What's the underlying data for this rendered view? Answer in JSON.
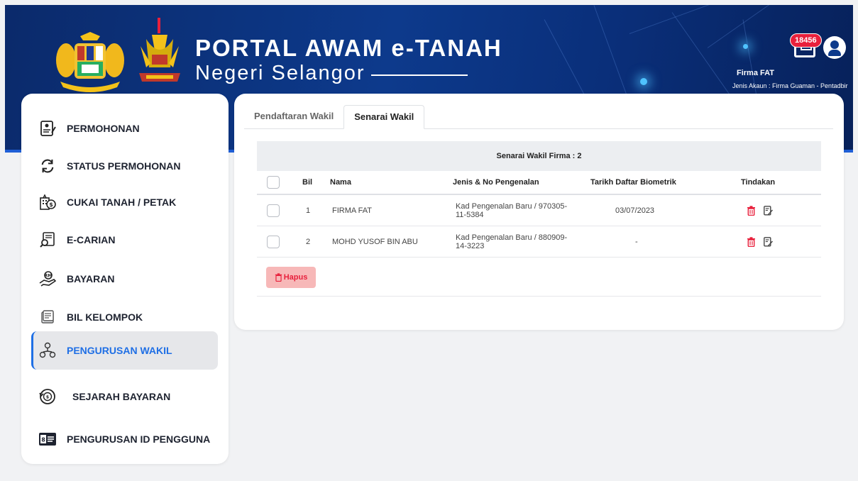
{
  "header": {
    "title": "PORTAL AWAM e-TANAH",
    "subtitle": "Negeri Selangor",
    "inbox_count": "18456",
    "user_name": "Firma FAT",
    "account_type": "Jenis Akaun : Firma Guaman - Pentadbir",
    "colors": {
      "header_bg": "#0d3a8c",
      "accent": "#1f6fe5",
      "badge": "#e8203c"
    }
  },
  "sidebar": {
    "items": [
      {
        "label": "PERMOHONAN",
        "icon": "form-document-icon"
      },
      {
        "label": "STATUS PERMOHONAN",
        "icon": "refresh-icon"
      },
      {
        "label": "CUKAI TANAH / PETAK",
        "icon": "tax-building-icon"
      },
      {
        "label": "E-CARIAN",
        "icon": "search-document-icon"
      },
      {
        "label": "BAYARAN",
        "icon": "hand-money-icon"
      },
      {
        "label": "BIL KELOMPOK",
        "icon": "bill-batch-icon"
      },
      {
        "label": "PENGURUSAN WAKIL",
        "icon": "people-network-icon",
        "active": true
      },
      {
        "label": "SEJARAH BAYARAN",
        "icon": "payment-history-icon"
      },
      {
        "label": "PENGURUSAN ID PENGGUNA",
        "icon": "id-card-icon"
      }
    ]
  },
  "main": {
    "tabs": [
      {
        "label": "Pendaftaran Wakil",
        "active": false
      },
      {
        "label": "Senarai Wakil",
        "active": true
      }
    ],
    "table": {
      "caption": "Senarai Wakil Firma : 2",
      "headers": {
        "bil": "Bil",
        "nama": "Nama",
        "id": "Jenis & No Pengenalan",
        "biometric": "Tarikh Daftar Biometrik",
        "action": "Tindakan"
      },
      "rows": [
        {
          "bil": "1",
          "nama": "FIRMA FAT",
          "id_line1": "Kad Pengenalan Baru / 970305-",
          "id_line2": "11-5384",
          "biometric": "03/07/2023"
        },
        {
          "bil": "2",
          "nama": "MOHD YUSOF BIN ABU",
          "id_line1": "Kad Pengenalan Baru / 880909-",
          "id_line2": "14-3223",
          "biometric": "-"
        }
      ]
    },
    "delete_button": "Hapus"
  }
}
